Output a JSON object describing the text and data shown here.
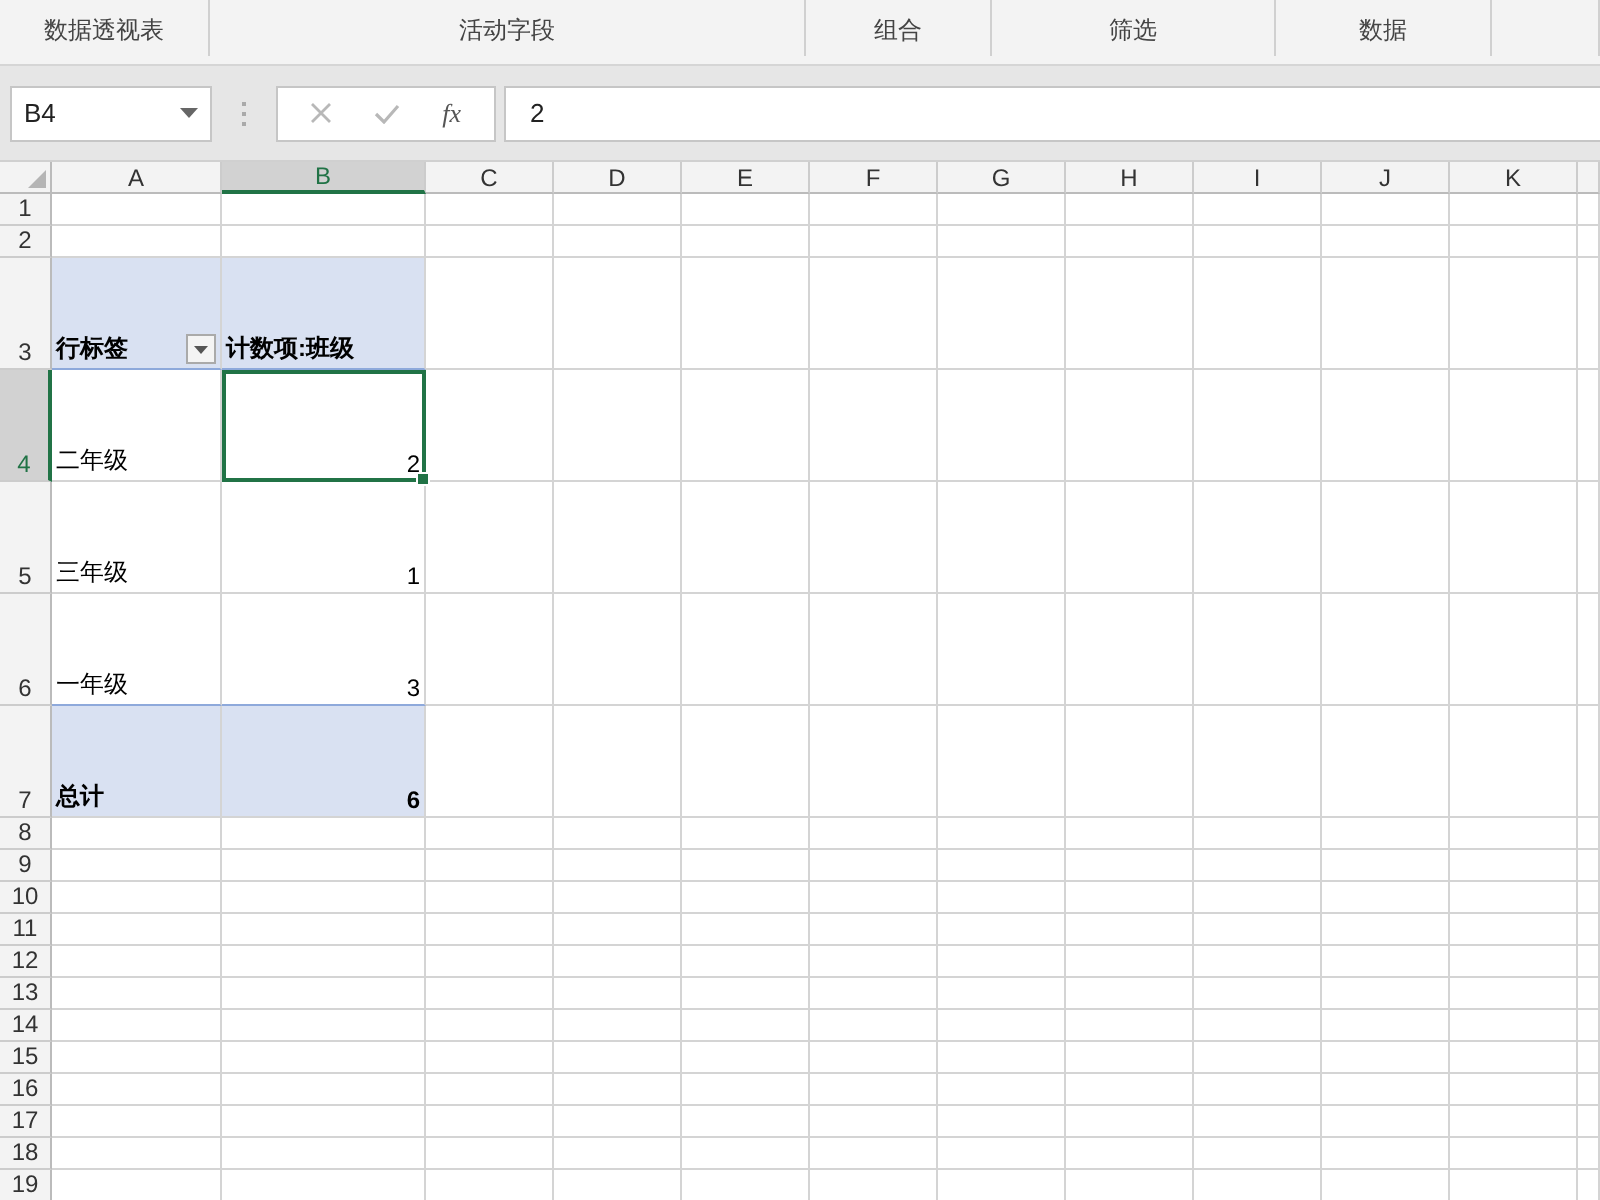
{
  "ribbon": {
    "groups": [
      {
        "label": "数据透视表"
      },
      {
        "label": "活动字段"
      },
      {
        "label": "组合"
      },
      {
        "label": "筛选"
      },
      {
        "label": "数据"
      }
    ]
  },
  "formula_bar": {
    "name_box": "B4",
    "function_label": "fx",
    "formula": "2"
  },
  "sheet": {
    "columns": [
      {
        "label": "A",
        "selected": false
      },
      {
        "label": "B",
        "selected": true
      },
      {
        "label": "C",
        "selected": false
      },
      {
        "label": "D",
        "selected": false
      },
      {
        "label": "E",
        "selected": false
      },
      {
        "label": "F",
        "selected": false
      },
      {
        "label": "G",
        "selected": false
      },
      {
        "label": "H",
        "selected": false
      },
      {
        "label": "I",
        "selected": false
      },
      {
        "label": "J",
        "selected": false
      },
      {
        "label": "K",
        "selected": false
      }
    ],
    "rows": [
      {
        "label": "1",
        "selected": false
      },
      {
        "label": "2",
        "selected": false
      },
      {
        "label": "3",
        "selected": false
      },
      {
        "label": "4",
        "selected": true
      },
      {
        "label": "5",
        "selected": false
      },
      {
        "label": "6",
        "selected": false
      },
      {
        "label": "7",
        "selected": false
      },
      {
        "label": "8",
        "selected": false
      },
      {
        "label": "9",
        "selected": false
      },
      {
        "label": "10",
        "selected": false
      },
      {
        "label": "11",
        "selected": false
      },
      {
        "label": "12",
        "selected": false
      },
      {
        "label": "13",
        "selected": false
      },
      {
        "label": "14",
        "selected": false
      },
      {
        "label": "15",
        "selected": false
      },
      {
        "label": "16",
        "selected": false
      },
      {
        "label": "17",
        "selected": false
      },
      {
        "label": "18",
        "selected": false
      },
      {
        "label": "19",
        "selected": false
      }
    ]
  },
  "pivot": {
    "header": {
      "row_label": "行标签",
      "value_label": "计数项:班级"
    },
    "rows": [
      {
        "label": "二年级",
        "value": "2",
        "selected": true
      },
      {
        "label": "三年级",
        "value": "1",
        "selected": false
      },
      {
        "label": "一年级",
        "value": "3",
        "selected": false
      }
    ],
    "total": {
      "label": "总计",
      "value": "6"
    }
  }
}
